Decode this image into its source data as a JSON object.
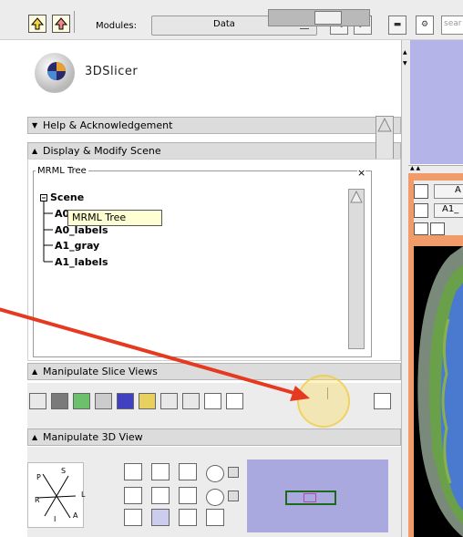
{
  "toolbar": {
    "modules_label": "Modules:",
    "module_selected": "Data",
    "search_placeholder": "sear"
  },
  "logo": {
    "text": "3DSlicer"
  },
  "sections": {
    "help": "Help & Acknowledgement",
    "display": "Display & Modify Scene",
    "slice_views": "Manipulate Slice Views",
    "view3d": "Manipulate 3D View"
  },
  "mrml_tree": {
    "title": "MRML Tree",
    "close_glyph": "×",
    "root": "Scene",
    "items": [
      "A0_",
      "A0_labels",
      "A1_gray",
      "A1_labels"
    ],
    "tooltip": "MRML Tree"
  },
  "compass": {
    "P": "P",
    "S": "S",
    "L": "L",
    "R": "R",
    "I": "I",
    "A": "A"
  },
  "slice_controls": {
    "row1": "A",
    "row2": "A1_"
  },
  "colors": {
    "slice_red": "#f19a6a",
    "view3d_blue": "#b4b4e8",
    "annotation_arrow": "#e53a1f"
  }
}
